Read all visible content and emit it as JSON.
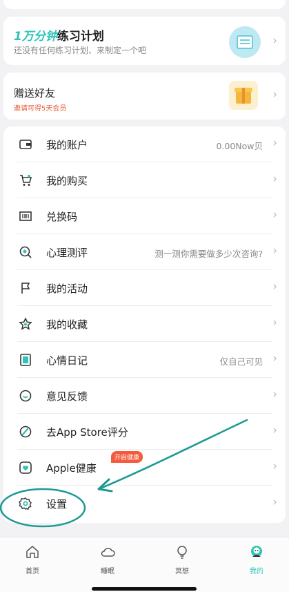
{
  "plan": {
    "title_highlight": "1万分钟",
    "title_rest": "练习计划",
    "subtitle": "还没有任何练习计划、来制定一个吧"
  },
  "gift": {
    "title": "赠送好友",
    "subtitle": "邀请可得5天会员"
  },
  "menu": {
    "items": [
      {
        "label": "我的账户",
        "value": "0.00Now贝",
        "icon": "wallet-icon"
      },
      {
        "label": "我的购买",
        "value": "",
        "icon": "cart-icon"
      },
      {
        "label": "兑换码",
        "value": "",
        "icon": "barcode-icon"
      },
      {
        "label": "心理测评",
        "value": "测一测你需要做多少次咨询?",
        "icon": "test-icon"
      },
      {
        "label": "我的活动",
        "value": "",
        "icon": "flag-icon"
      },
      {
        "label": "我的收藏",
        "value": "",
        "icon": "star-icon"
      },
      {
        "label": "心情日记",
        "value": "仅自己可见",
        "icon": "diary-icon"
      },
      {
        "label": "意见反馈",
        "value": "",
        "icon": "feedback-icon"
      },
      {
        "label": "去App Store评分",
        "value": "",
        "icon": "rate-icon"
      },
      {
        "label": "Apple健康",
        "value": "",
        "icon": "health-icon",
        "badge": "开启健康"
      },
      {
        "label": "设置",
        "value": "",
        "icon": "gear-icon"
      }
    ]
  },
  "tabbar": {
    "tabs": [
      {
        "label": "首页",
        "icon": "home-icon"
      },
      {
        "label": "睡眠",
        "icon": "cloud-icon"
      },
      {
        "label": "冥想",
        "icon": "bulb-icon"
      },
      {
        "label": "我的",
        "icon": "profile-icon"
      }
    ]
  },
  "colors": {
    "accent": "#2ec4b6",
    "badge": "#f45a3c",
    "annotation": "#1b9a93"
  }
}
